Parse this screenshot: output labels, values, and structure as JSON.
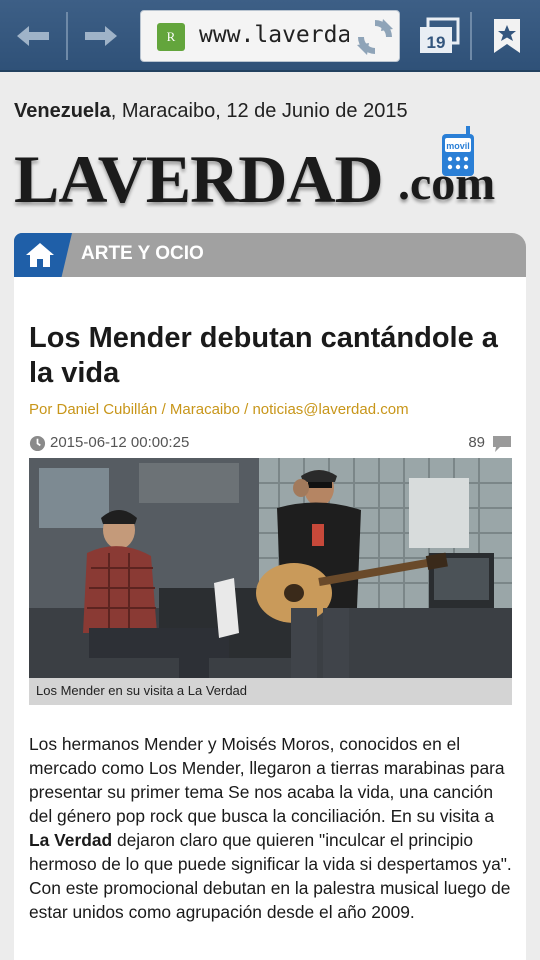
{
  "browser": {
    "url": "www.laverdad.com",
    "favicon_letter": "R",
    "tab_count": "19"
  },
  "dateline": {
    "country": "Venezuela",
    "rest": ", Maracaibo, 12 de Junio de 2015"
  },
  "logo": {
    "main": "LAVERDAD",
    "suffix": ".com",
    "badge": "movil"
  },
  "section": {
    "label": "ARTE Y OCIO"
  },
  "article": {
    "title": "Los Mender debutan cantándole a la vida",
    "byline": "Por Daniel Cubillán / Maracaibo / noticias@laverdad.com",
    "timestamp": "2015-06-12 00:00:25",
    "comment_count": "89",
    "photo_caption": "Los Mender en su visita a La Verdad",
    "body_part1": "Los hermanos Mender y Moisés Moros, conocidos en el mercado como Los Mender, llegaron a tierras marabinas para presentar su primer tema Se nos acaba la vida, una canción del género pop rock que busca la conciliación. En su visita a ",
    "body_bold": "La Verdad",
    "body_part2": " dejaron claro que quieren \"inculcar el principio hermoso de lo que puede significar la vida si despertamos ya\". Con este promocional debutan en la palestra musical luego de estar unidos como agrupación desde el año 2009."
  },
  "colors": {
    "toolbar": "#34567e",
    "section_bar": "#a1a1a1",
    "home_tab": "#1f5fa8",
    "byline": "#c8961a"
  },
  "icons": [
    "back-arrow-icon",
    "forward-arrow-icon",
    "reload-icon",
    "tabs-icon",
    "bookmark-icon",
    "home-icon",
    "clock-icon",
    "comment-icon",
    "phone-icon"
  ]
}
